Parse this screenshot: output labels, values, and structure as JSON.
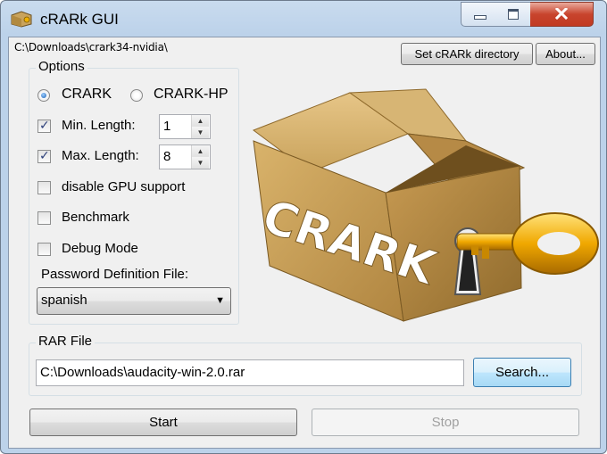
{
  "window": {
    "title": "cRARk GUI",
    "app_icon": "crark-app-icon",
    "controls": {
      "minimize": "minimize-icon",
      "maximize": "maximize-icon",
      "close": "close-icon"
    }
  },
  "header": {
    "directory_path": "C:\\Downloads\\crark34-nvidia\\",
    "set_dir_label": "Set cRARk directory",
    "about_label": "About..."
  },
  "options": {
    "group_title": "Options",
    "radio_crark_label": "CRARK",
    "radio_crark_selected": true,
    "radio_crarkhp_label": "CRARK-HP",
    "radio_crarkhp_selected": false,
    "min_length_label": "Min. Length:",
    "min_length_checked": true,
    "min_length_value": "1",
    "max_length_label": "Max. Length:",
    "max_length_checked": true,
    "max_length_value": "8",
    "disable_gpu_label": "disable GPU support",
    "disable_gpu_checked": false,
    "benchmark_label": "Benchmark",
    "benchmark_checked": false,
    "debug_mode_label": "Debug Mode",
    "debug_mode_checked": false,
    "password_def_label": "Password Definition File:",
    "password_def_value": "spanish"
  },
  "logo": {
    "text": "CRARK",
    "description": "box-with-key-logo"
  },
  "rar": {
    "group_title": "RAR File",
    "file_path": "C:\\Downloads\\audacity-win-2.0.rar",
    "search_label": "Search..."
  },
  "actions": {
    "start_label": "Start",
    "stop_label": "Stop",
    "stop_enabled": false
  },
  "colors": {
    "title_bar": "#bcd2ea",
    "close_button": "#c8442d",
    "box": "#c9a35c",
    "key": "#f0a800"
  }
}
